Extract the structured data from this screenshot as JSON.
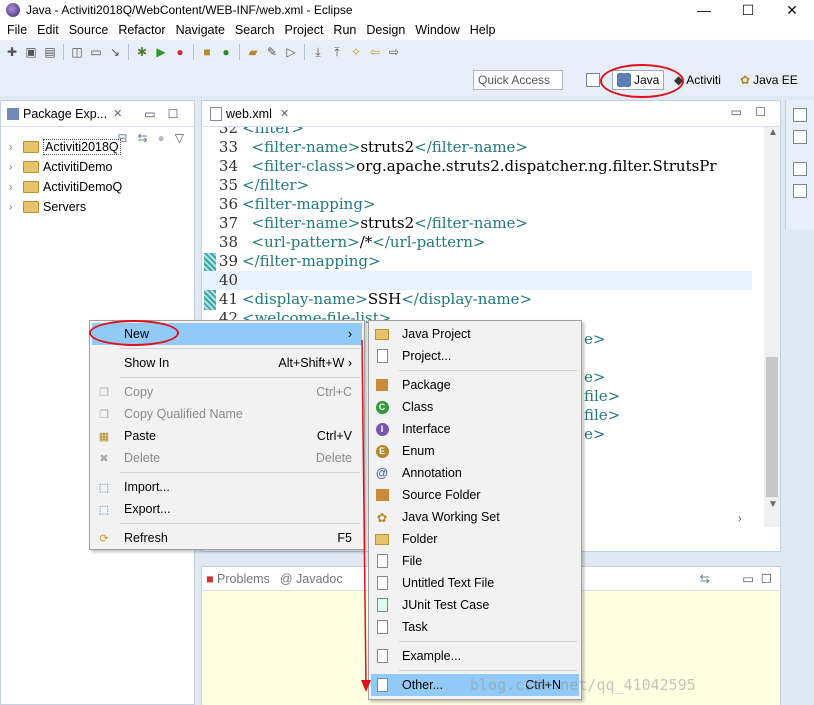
{
  "window": {
    "title": "Java - Activiti2018Q/WebContent/WEB-INF/web.xml - Eclipse",
    "controls": [
      "—",
      "☐",
      "✕"
    ]
  },
  "menubar": [
    "File",
    "Edit",
    "Source",
    "Refactor",
    "Navigate",
    "Search",
    "Project",
    "Run",
    "Design",
    "Window",
    "Help"
  ],
  "perspectives": {
    "quick_access": "Quick Access",
    "items": [
      "Java",
      "Activiti",
      "Java EE"
    ]
  },
  "package_explorer": {
    "title": "Package Exp...",
    "projects": [
      "Activiti2018Q",
      "ActivitiDemo",
      "ActivitiDemoQ",
      "Servers"
    ]
  },
  "editor": {
    "tab": "web.xml",
    "lines": [
      {
        "n": "32",
        "tag": "<filter>",
        "text": "",
        "end": ""
      },
      {
        "n": "33",
        "tag": "  <filter-name>",
        "text": "struts2",
        "end": "</filter-name>"
      },
      {
        "n": "34",
        "tag": "  <filter-class>",
        "text": "org.apache.struts2.dispatcher.ng.filter.StrutsPr",
        "end": ""
      },
      {
        "n": "35",
        "tag": "</filter>",
        "text": "",
        "end": ""
      },
      {
        "n": "36",
        "tag": "<filter-mapping>",
        "text": "",
        "end": ""
      },
      {
        "n": "37",
        "tag": "  <filter-name>",
        "text": "struts2",
        "end": "</filter-name>"
      },
      {
        "n": "38",
        "tag": "  <url-pattern>",
        "text": "/*",
        "end": "</url-pattern>"
      },
      {
        "n": "39",
        "tag": "</filter-mapping>",
        "text": "",
        "end": ""
      },
      {
        "n": "40",
        "tag": "",
        "text": "",
        "end": ""
      },
      {
        "n": "41",
        "tag": "<display-name>",
        "text": "SSH",
        "end": "</display-name>"
      },
      {
        "n": "42",
        "tag": "<welcome-file-list>",
        "text": "",
        "end": ""
      }
    ],
    "partial_right": [
      "e>",
      "e>",
      "file>",
      "file>",
      "e>"
    ]
  },
  "bottom_panel": {
    "tabs": [
      "Problems",
      "Javadoc"
    ]
  },
  "context_menu": {
    "items": [
      {
        "label": "New",
        "shortcut": "›",
        "state": "active"
      },
      {
        "label": "Show In",
        "shortcut": "Alt+Shift+W ›",
        "state": "normal"
      },
      {
        "label": "Copy",
        "shortcut": "Ctrl+C",
        "state": "disabled"
      },
      {
        "label": "Copy Qualified Name",
        "shortcut": "",
        "state": "disabled"
      },
      {
        "label": "Paste",
        "shortcut": "Ctrl+V",
        "state": "normal"
      },
      {
        "label": "Delete",
        "shortcut": "Delete",
        "state": "disabled"
      },
      {
        "label": "Import...",
        "shortcut": "",
        "state": "normal"
      },
      {
        "label": "Export...",
        "shortcut": "",
        "state": "normal"
      },
      {
        "label": "Refresh",
        "shortcut": "F5",
        "state": "normal"
      }
    ]
  },
  "new_submenu": {
    "items": [
      {
        "label": "Java Project",
        "shortcut": ""
      },
      {
        "label": "Project...",
        "shortcut": ""
      },
      {
        "label": "Package",
        "shortcut": ""
      },
      {
        "label": "Class",
        "shortcut": ""
      },
      {
        "label": "Interface",
        "shortcut": ""
      },
      {
        "label": "Enum",
        "shortcut": ""
      },
      {
        "label": "Annotation",
        "shortcut": ""
      },
      {
        "label": "Source Folder",
        "shortcut": ""
      },
      {
        "label": "Java Working Set",
        "shortcut": ""
      },
      {
        "label": "Folder",
        "shortcut": ""
      },
      {
        "label": "File",
        "shortcut": ""
      },
      {
        "label": "Untitled Text File",
        "shortcut": ""
      },
      {
        "label": "JUnit Test Case",
        "shortcut": ""
      },
      {
        "label": "Task",
        "shortcut": ""
      },
      {
        "label": "Example...",
        "shortcut": ""
      },
      {
        "label": "Other...",
        "shortcut": "Ctrl+N"
      }
    ]
  },
  "watermark": "blog.csdn.net/qq_41042595",
  "colors": {
    "menu_highlight": "#91c9f7",
    "annotation_red": "#e0101c",
    "xml_tag": "#227a7a"
  }
}
